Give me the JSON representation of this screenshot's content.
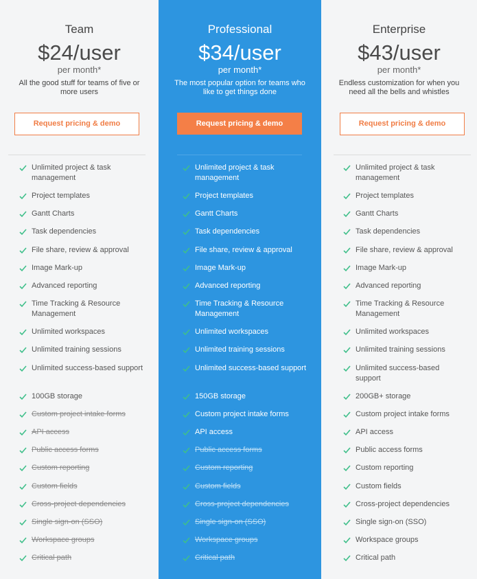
{
  "colors": {
    "accent": "#f07d45",
    "pro_bg": "#2d95e0",
    "check": "#3fbf8a"
  },
  "plans": [
    {
      "name": "Team",
      "price": "$24/user",
      "period": "per month*",
      "description": "All the good stuff for teams of five or more users",
      "cta": "Request pricing & demo",
      "features": [
        {
          "label": "Unlimited project & task management",
          "included": true
        },
        {
          "label": "Project templates",
          "included": true
        },
        {
          "label": "Gantt Charts",
          "included": true
        },
        {
          "label": "Task dependencies",
          "included": true
        },
        {
          "label": "File share, review & approval",
          "included": true
        },
        {
          "label": "Image Mark-up",
          "included": true
        },
        {
          "label": "Advanced reporting",
          "included": true
        },
        {
          "label": "Time Tracking & Resource Management",
          "included": true
        },
        {
          "label": "Unlimited workspaces",
          "included": true
        },
        {
          "label": "Unlimited training sessions",
          "included": true
        },
        {
          "label": "Unlimited success-based support",
          "included": true
        },
        {
          "label": "100GB storage",
          "included": true
        },
        {
          "label": "Custom project intake forms",
          "included": false
        },
        {
          "label": "API access",
          "included": false
        },
        {
          "label": "Public access forms",
          "included": false
        },
        {
          "label": "Custom reporting",
          "included": false
        },
        {
          "label": "Custom fields",
          "included": false
        },
        {
          "label": "Cross-project dependencies",
          "included": false
        },
        {
          "label": "Single sign-on (SSO)",
          "included": false
        },
        {
          "label": "Workspace groups",
          "included": false
        },
        {
          "label": "Critical path",
          "included": false
        }
      ]
    },
    {
      "name": "Professional",
      "price": "$34/user",
      "period": "per month*",
      "description": "The most popular option for teams who like to get things done",
      "cta": "Request pricing & demo",
      "features": [
        {
          "label": "Unlimited project & task management",
          "included": true
        },
        {
          "label": "Project templates",
          "included": true
        },
        {
          "label": "Gantt Charts",
          "included": true
        },
        {
          "label": "Task dependencies",
          "included": true
        },
        {
          "label": "File share, review & approval",
          "included": true
        },
        {
          "label": "Image Mark-up",
          "included": true
        },
        {
          "label": "Advanced reporting",
          "included": true
        },
        {
          "label": "Time Tracking & Resource Management",
          "included": true
        },
        {
          "label": "Unlimited workspaces",
          "included": true
        },
        {
          "label": "Unlimited training sessions",
          "included": true
        },
        {
          "label": "Unlimited success-based support",
          "included": true
        },
        {
          "label": "150GB storage",
          "included": true
        },
        {
          "label": "Custom project intake forms",
          "included": true
        },
        {
          "label": "API access",
          "included": true
        },
        {
          "label": "Public access forms",
          "included": false
        },
        {
          "label": "Custom reporting",
          "included": false
        },
        {
          "label": "Custom fields",
          "included": false
        },
        {
          "label": "Cross-project dependencies",
          "included": false
        },
        {
          "label": "Single sign-on (SSO)",
          "included": false
        },
        {
          "label": "Workspace groups",
          "included": false
        },
        {
          "label": "Critical path",
          "included": false
        }
      ]
    },
    {
      "name": "Enterprise",
      "price": "$43/user",
      "period": "per month*",
      "description": "Endless customization for when you need all the bells and whistles",
      "cta": "Request pricing & demo",
      "features": [
        {
          "label": "Unlimited project & task management",
          "included": true
        },
        {
          "label": "Project templates",
          "included": true
        },
        {
          "label": "Gantt Charts",
          "included": true
        },
        {
          "label": "Task dependencies",
          "included": true
        },
        {
          "label": "File share, review & approval",
          "included": true
        },
        {
          "label": "Image Mark-up",
          "included": true
        },
        {
          "label": "Advanced reporting",
          "included": true
        },
        {
          "label": "Time Tracking & Resource Management",
          "included": true
        },
        {
          "label": "Unlimited workspaces",
          "included": true
        },
        {
          "label": "Unlimited training sessions",
          "included": true
        },
        {
          "label": "Unlimited success-based support",
          "included": true
        },
        {
          "label": "200GB+ storage",
          "included": true
        },
        {
          "label": "Custom project intake forms",
          "included": true
        },
        {
          "label": "API access",
          "included": true
        },
        {
          "label": "Public access forms",
          "included": true
        },
        {
          "label": "Custom reporting",
          "included": true
        },
        {
          "label": "Custom fields",
          "included": true
        },
        {
          "label": "Cross-project dependencies",
          "included": true
        },
        {
          "label": "Single sign-on (SSO)",
          "included": true
        },
        {
          "label": "Workspace groups",
          "included": true
        },
        {
          "label": "Critical path",
          "included": true
        }
      ]
    }
  ]
}
